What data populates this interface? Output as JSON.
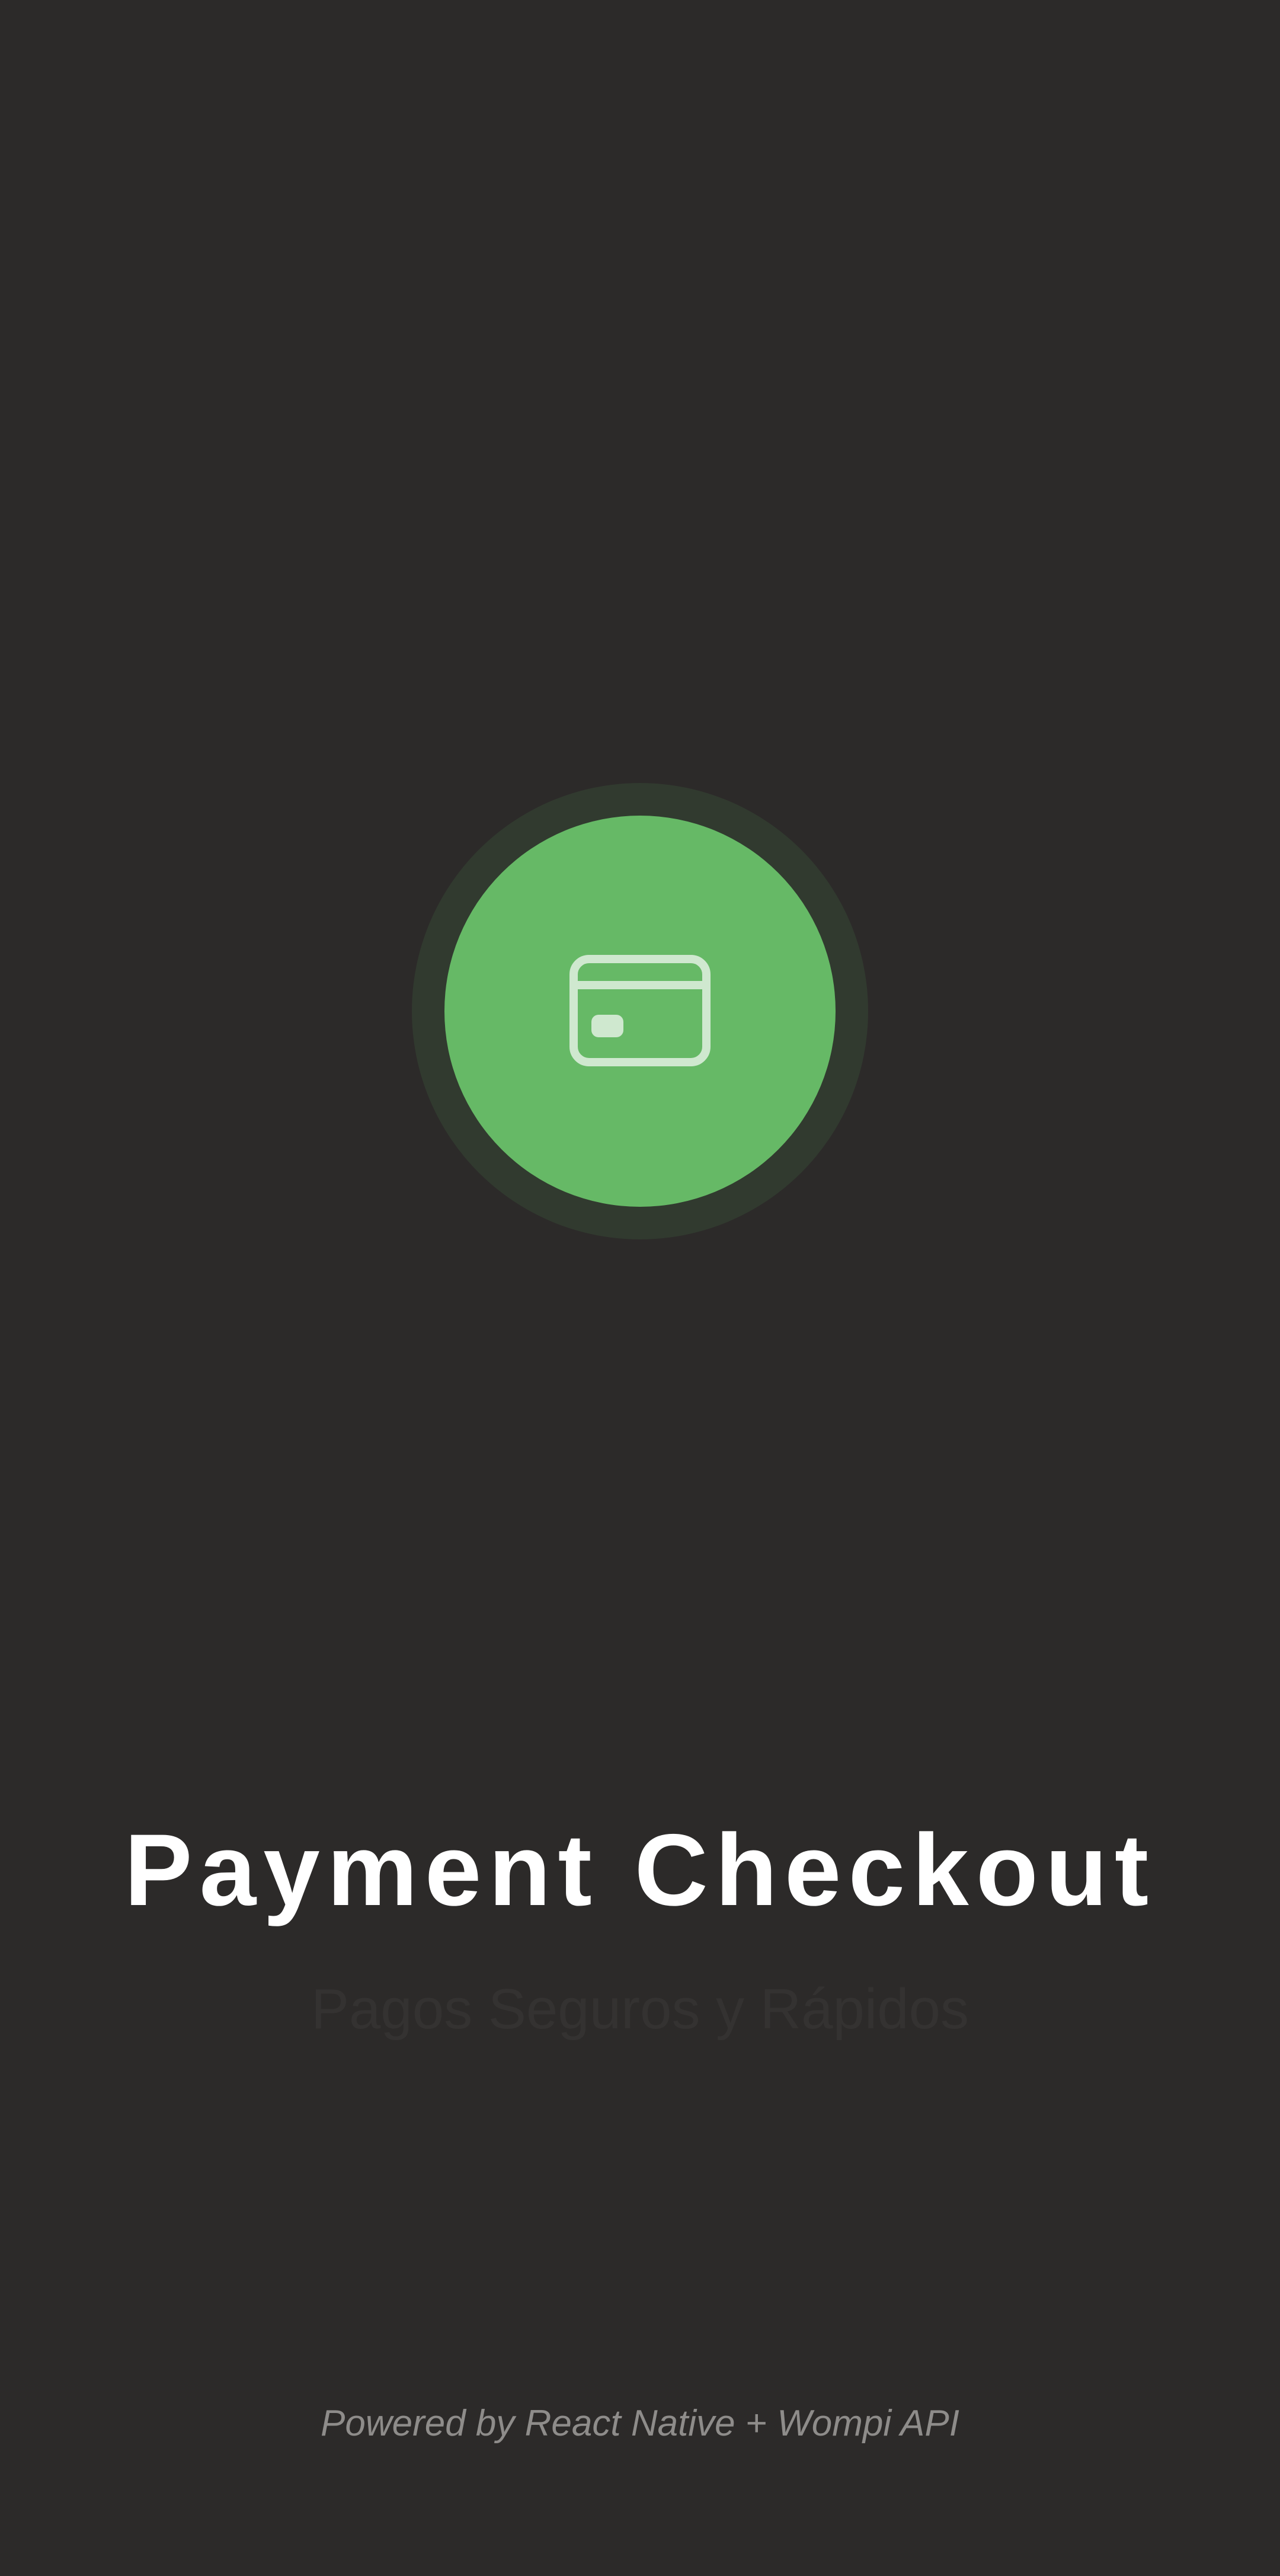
{
  "splash": {
    "logo_icon": "credit-card-icon",
    "title": "Payment Checkout",
    "subtitle": "Pagos Seguros y Rápidos",
    "footer": "Powered by React Native + Wompi API"
  },
  "colors": {
    "background": "#2c2a29",
    "accent": "#66b966",
    "accent_halo": "#313a2f",
    "icon_stroke": "#cfe8cf",
    "title": "#ffffff",
    "subtitle": "#343231",
    "footer": "#8e8c8a"
  }
}
